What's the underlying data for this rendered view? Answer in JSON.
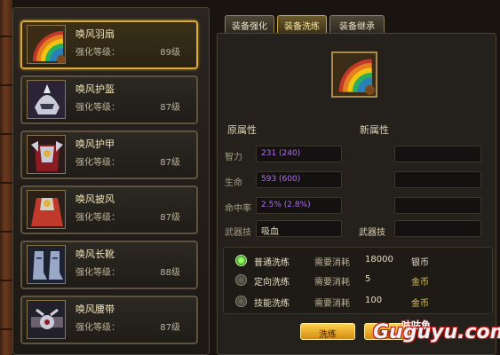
{
  "tabs": [
    {
      "label": "装备强化",
      "active": false
    },
    {
      "label": "装备洗练",
      "active": true
    },
    {
      "label": "装备继承",
      "active": false
    }
  ],
  "items": [
    {
      "name": "唤风羽扇",
      "level_label": "强化等级：",
      "level": "89级",
      "icon": "feather-fan-icon",
      "selected": true
    },
    {
      "name": "唤风护盔",
      "level_label": "强化等级：",
      "level": "87级",
      "icon": "helmet-icon",
      "selected": false
    },
    {
      "name": "唤风护甲",
      "level_label": "强化等级：",
      "level": "87级",
      "icon": "armor-icon",
      "selected": false
    },
    {
      "name": "唤风披风",
      "level_label": "强化等级：",
      "level": "87级",
      "icon": "cape-icon",
      "selected": false
    },
    {
      "name": "唤风长靴",
      "level_label": "强化等级：",
      "level": "88级",
      "icon": "boots-icon",
      "selected": false
    },
    {
      "name": "唤风腰带",
      "level_label": "强化等级：",
      "level": "87级",
      "icon": "belt-icon",
      "selected": false
    }
  ],
  "sections": {
    "original": "原属性",
    "new": "新属性"
  },
  "attributes": [
    {
      "label": "智力",
      "original": "231 (240)",
      "new": ""
    },
    {
      "label": "生命",
      "original": "593 (600)",
      "new": ""
    },
    {
      "label": "命中率",
      "original": "2.5% (2.8%)",
      "new": ""
    }
  ],
  "weapon_skill": {
    "label": "武器技",
    "original": "吸血",
    "new_label": "武器技",
    "new": ""
  },
  "options": [
    {
      "name": "普通洗练",
      "cost_label": "需要消耗",
      "cost": "18000",
      "currency": "银币",
      "checked": true
    },
    {
      "name": "定向洗练",
      "cost_label": "需要消耗",
      "cost": "5",
      "currency": "金币",
      "checked": false
    },
    {
      "name": "技能洗练",
      "cost_label": "需要消耗",
      "cost": "100",
      "currency": "金币",
      "checked": false
    }
  ],
  "buttons": {
    "refine": "洗练",
    "replace": "替换"
  },
  "watermark": {
    "text": "Guguyu.com",
    "cn": "咕咕鱼"
  },
  "colors": {
    "selected_border": "#d9a83a",
    "purple_value": "#b06cf0",
    "gold_currency": "#e8c23a",
    "button": "#ffd24a"
  }
}
